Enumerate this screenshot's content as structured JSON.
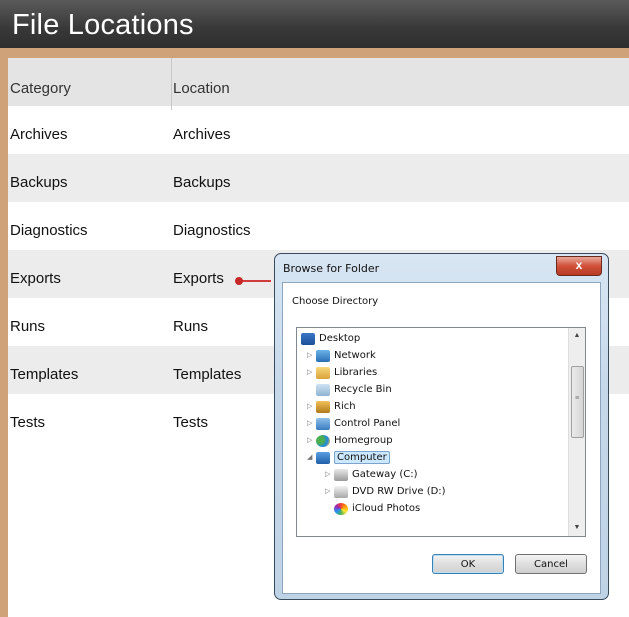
{
  "page": {
    "title": "File Locations"
  },
  "table": {
    "headers": [
      "Category",
      "Location"
    ],
    "rows": [
      {
        "category": "Archives",
        "location": "Archives"
      },
      {
        "category": "Backups",
        "location": "Backups"
      },
      {
        "category": "Diagnostics",
        "location": "Diagnostics"
      },
      {
        "category": "Exports",
        "location": "Exports"
      },
      {
        "category": "Runs",
        "location": "Runs"
      },
      {
        "category": "Templates",
        "location": "Templates"
      },
      {
        "category": "Tests",
        "location": "Tests"
      }
    ]
  },
  "dialog": {
    "title": "Browse for Folder",
    "close_label": "x",
    "prompt": "Choose Directory",
    "tree": [
      {
        "label": "Desktop",
        "icon": "desktop-icon"
      },
      {
        "label": "Network",
        "icon": "network-icon"
      },
      {
        "label": "Libraries",
        "icon": "libraries-icon"
      },
      {
        "label": "Recycle Bin",
        "icon": "recycle-bin-icon"
      },
      {
        "label": "Rich",
        "icon": "user-folder-icon"
      },
      {
        "label": "Control Panel",
        "icon": "control-panel-icon"
      },
      {
        "label": "Homegroup",
        "icon": "homegroup-icon"
      },
      {
        "label": "Computer",
        "icon": "computer-icon"
      },
      {
        "label": "Gateway (C:)",
        "icon": "hard-drive-icon"
      },
      {
        "label": "DVD RW Drive (D:)",
        "icon": "dvd-drive-icon"
      },
      {
        "label": "iCloud Photos",
        "icon": "icloud-photos-icon"
      }
    ],
    "ok_label": "OK",
    "cancel_label": "Cancel"
  },
  "colors": {
    "title_bar": "#3a3a3a",
    "accent_border": "#cfa27a",
    "pointer": "#d23b3b",
    "selection": "#cce8ff"
  }
}
